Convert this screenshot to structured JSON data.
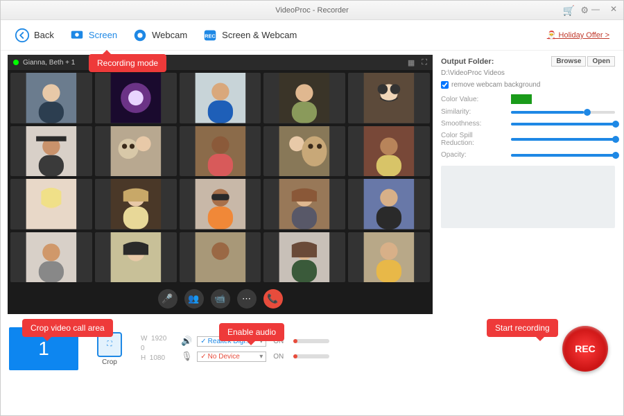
{
  "title": "VideoProc - Recorder",
  "toolbar": {
    "back": "Back",
    "screen": "Screen",
    "webcam": "Webcam",
    "both": "Screen & Webcam",
    "offer": "Holiday Offer >"
  },
  "call": {
    "participants": "Gianna, Beth + 1"
  },
  "side": {
    "outputFolder": "Output Folder:",
    "browse": "Browse",
    "open": "Open",
    "path": "D:\\VideoProc Videos",
    "removeBg": "remove webcam background",
    "colorValue": "Color Value:",
    "similarity": "Similarity:",
    "smoothness": "Smoothness:",
    "spill": "Color Spill Reduction:",
    "opacity": "Opacity:"
  },
  "bottom": {
    "monitorNum": "1",
    "crop": "Crop",
    "wLabel": "W",
    "wVal": "1920",
    "hLabel": "H",
    "hVal": "1080",
    "g": "0",
    "speakerDev": "Realtek Digi...",
    "micDev": "No Device",
    "on": "ON",
    "rec": "REC"
  },
  "ann": {
    "mode": "Recording mode",
    "crop": "Crop video call area",
    "audio": "Enable audio",
    "start": "Start recording"
  }
}
